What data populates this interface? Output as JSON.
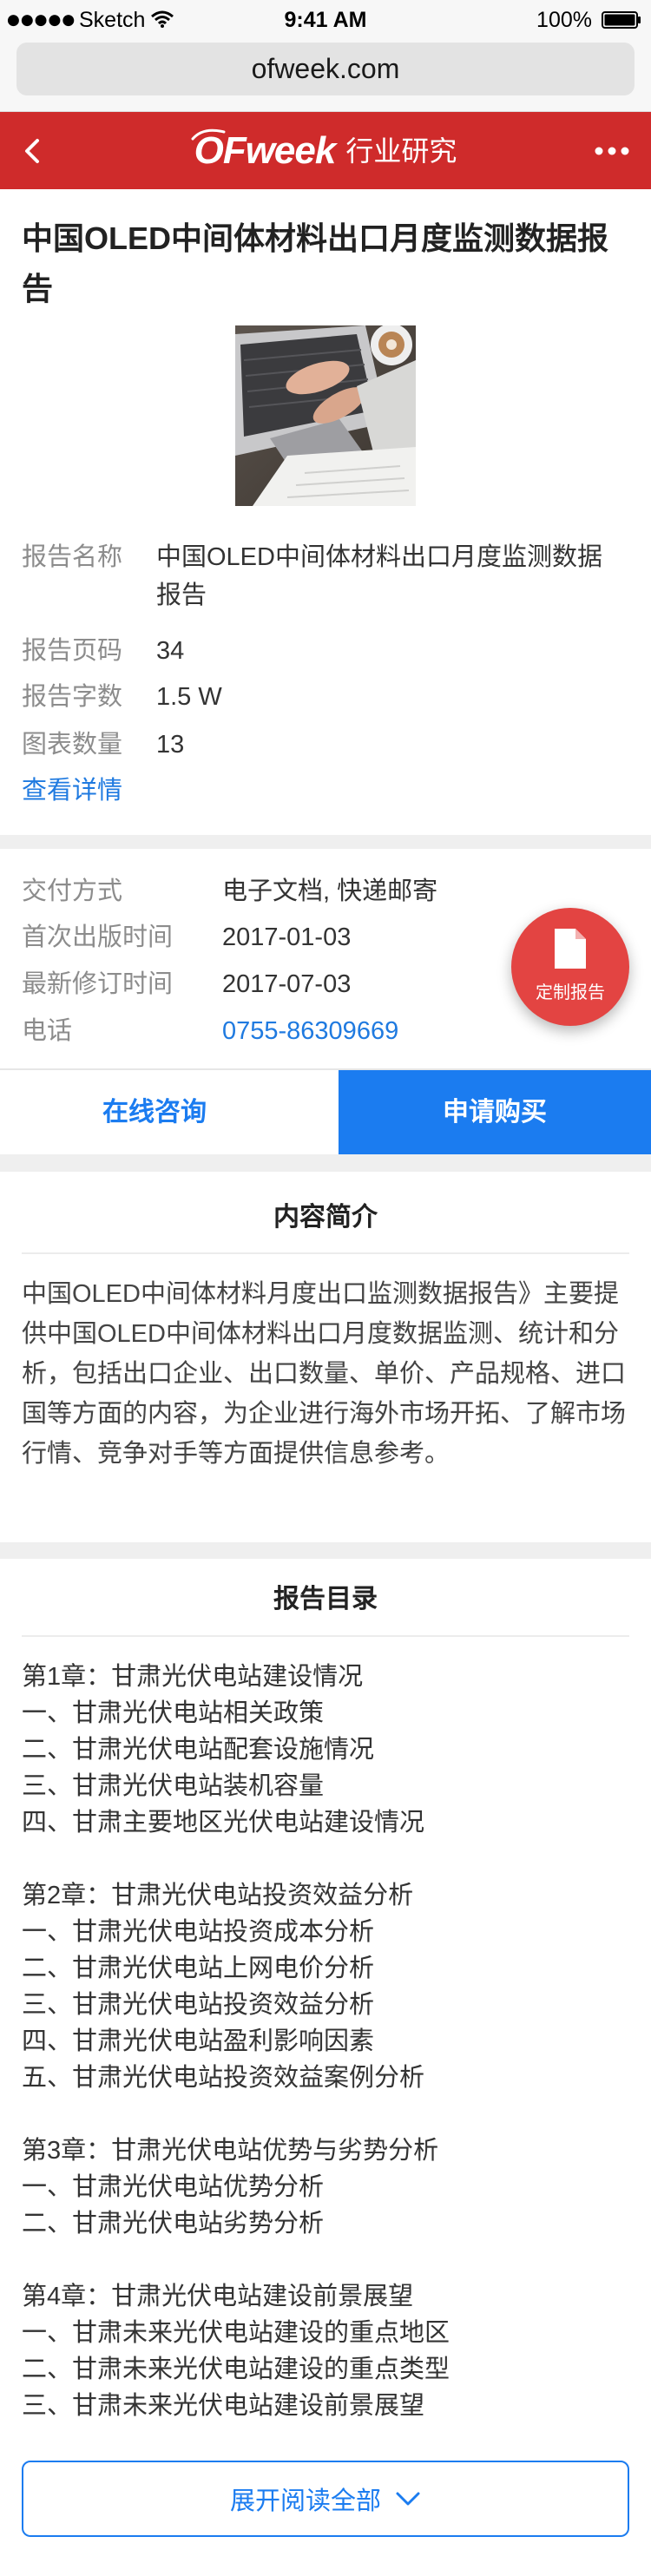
{
  "status_bar": {
    "signal": "●●●●●",
    "carrier": "Sketch",
    "time": "9:41 AM",
    "battery": "100%",
    "wifi_icon": "wifi-icon",
    "battery_icon": "battery-icon"
  },
  "browser": {
    "url": "ofweek.com"
  },
  "header": {
    "logo": "OFweek",
    "section_title": "行业研究",
    "back_icon": "chevron-left-icon",
    "more_icon": "more-dots-icon",
    "color": "#cf2b2b"
  },
  "report": {
    "title": "中国OLED中间体材料出口月度监测数据报告",
    "info": [
      {
        "label": "报告名称",
        "value": "中国OLED中间体材料出口月度监测数据报告"
      },
      {
        "label": "报告页码",
        "value": "34"
      },
      {
        "label": "报告字数",
        "value": "1.5 W"
      },
      {
        "label": "图表数量",
        "value": "13"
      }
    ],
    "details_link": "查看详情"
  },
  "delivery": {
    "rows": [
      {
        "label": "交付方式",
        "value": "电子文档, 快递邮寄"
      },
      {
        "label": "首次出版时间",
        "value": "2017-01-03"
      },
      {
        "label": "最新修订时间",
        "value": "2017-07-03"
      },
      {
        "label": "电话",
        "value": "0755-86309669"
      }
    ]
  },
  "custom_report_fab": {
    "label": "定制报告",
    "icon": "document-icon",
    "color": "#e34442"
  },
  "actions": {
    "consult": "在线咨询",
    "buy": "申请购买",
    "accent": "#1b7cf0"
  },
  "intro": {
    "heading": "内容简介",
    "text": "中国OLED中间体材料月度出口监测数据报告》主要提供中国OLED中间体材料出口月度数据监测、统计和分析，包括出口企业、出口数量、单价、产品规格、进口国等方面的内容，为企业进行海外市场开拓、了解市场行情、竞争对手等方面提供信息参考。"
  },
  "toc": {
    "heading": "报告目录",
    "chapters": [
      {
        "title": "第1章：甘肃光伏电站建设情况",
        "items": [
          "一、甘肃光伏电站相关政策",
          "二、甘肃光伏电站配套设施情况",
          "三、甘肃光伏电站装机容量",
          "四、甘肃主要地区光伏电站建设情况"
        ]
      },
      {
        "title": "第2章：甘肃光伏电站投资效益分析",
        "items": [
          "一、甘肃光伏电站投资成本分析",
          "二、甘肃光伏电站上网电价分析",
          "三、甘肃光伏电站投资效益分析",
          "四、甘肃光伏电站盈利影响因素",
          "五、甘肃光伏电站投资效益案例分析"
        ]
      },
      {
        "title": "第3章：甘肃光伏电站优势与劣势分析",
        "items": [
          "一、甘肃光伏电站优势分析",
          "二、甘肃光伏电站劣势分析"
        ]
      },
      {
        "title": "第4章：甘肃光伏电站建设前景展望",
        "items": [
          "一、甘肃未来光伏电站建设的重点地区",
          "二、甘肃未来光伏电站建设的重点类型",
          "三、甘肃未来光伏电站建设前景展望"
        ]
      }
    ]
  },
  "expand": {
    "label": "展开阅读全部",
    "icon": "chevron-down-icon"
  }
}
